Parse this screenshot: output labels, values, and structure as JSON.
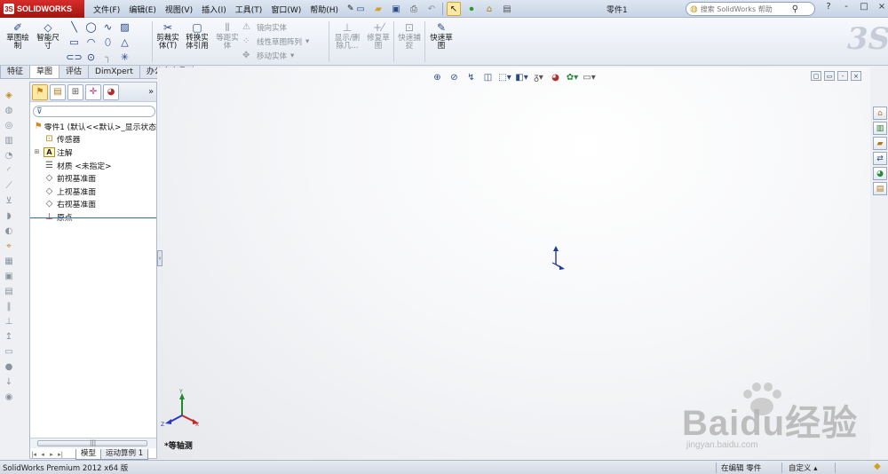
{
  "app": {
    "logo_text": "SOLIDWORKS",
    "doc_title": "零件1"
  },
  "menu": [
    "文件(F)",
    "编辑(E)",
    "视图(V)",
    "插入(I)",
    "工具(T)",
    "窗口(W)",
    "帮助(H)"
  ],
  "search": {
    "placeholder": "搜索 SolidWorks 帮助"
  },
  "window_controls": [
    "?",
    "-",
    "□",
    "×"
  ],
  "ribbon": {
    "sketch": "草图绘制",
    "smart_dim": "智能尺寸",
    "trim": "剪裁实体(T)",
    "convert": "转换实体引用",
    "offset": "等距实体",
    "mirror": "镜向实体",
    "linear_pattern": "线性草图阵列",
    "move": "移动实体",
    "display_delete": "显示/删除几...",
    "repair": "修复草图",
    "rapid_snap": "快速捕捉",
    "rapid_sketch": "快速草图"
  },
  "cm_tabs": [
    "特征",
    "草图",
    "评估",
    "DimXpert",
    "办公室产品"
  ],
  "active_cm_tab": "草图",
  "filter_icon": "filter-icon",
  "tree": [
    {
      "label": "零件1  (默认<<默认>_显示状态",
      "icon": "part-icon",
      "expandable": false
    },
    {
      "label": "传感器",
      "icon": "sensor-icon",
      "expandable": false
    },
    {
      "label": "注解",
      "icon": "annotation-icon",
      "expandable": true
    },
    {
      "label": "材质 <未指定>",
      "icon": "material-icon",
      "expandable": false
    },
    {
      "label": "前视基准面",
      "icon": "plane-icon",
      "expandable": false
    },
    {
      "label": "上视基准面",
      "icon": "plane-icon",
      "expandable": false
    },
    {
      "label": "右视基准面",
      "icon": "plane-icon",
      "expandable": false
    },
    {
      "label": "原点",
      "icon": "origin-icon",
      "expandable": false
    }
  ],
  "graphics": {
    "view_name": "*等轴测"
  },
  "bottom_tabs": [
    "模型",
    "运动算例 1"
  ],
  "status": {
    "product": "SolidWorks Premium 2012 x64 版",
    "mode": "在编辑 零件",
    "units": "自定义"
  },
  "watermark": {
    "big": "Baidu经验",
    "small": "jingyan.baidu.com"
  },
  "colors": {
    "logo_red": "#c2201c",
    "accent_blue": "#2c6ab7",
    "selection_yellow": "#fde9a4"
  }
}
